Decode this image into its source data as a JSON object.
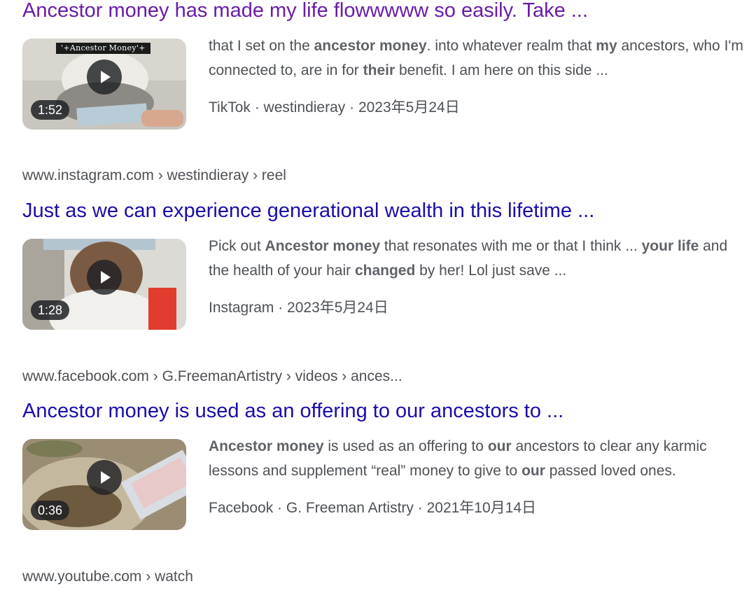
{
  "results": [
    {
      "title": "Ancestor money has made my life flowwwww so easily. Take ...",
      "visited": true,
      "thumbnail": {
        "overlay_text": "'+Ancestor Money'+",
        "duration": "1:52"
      },
      "snippet": [
        {
          "text": "that I set on the ",
          "bold": false
        },
        {
          "text": "ancestor money",
          "bold": true
        },
        {
          "text": ". into whatever realm that ",
          "bold": false
        },
        {
          "text": "my",
          "bold": true
        },
        {
          "text": " ancestors, who I'm connected to, are in for ",
          "bold": false
        },
        {
          "text": "their",
          "bold": true
        },
        {
          "text": " benefit. I am here on this side ...",
          "bold": false
        }
      ],
      "meta": "TikTok · westindieray · 2023年5月24日"
    },
    {
      "cite": "www.instagram.com › westindieray › reel",
      "title": "Just as we can experience generational wealth in this lifetime ...",
      "visited": false,
      "thumbnail": {
        "duration": "1:28"
      },
      "snippet": [
        {
          "text": "Pick out ",
          "bold": false
        },
        {
          "text": "Ancestor money",
          "bold": true
        },
        {
          "text": " that resonates with me or that I think ... ",
          "bold": false
        },
        {
          "text": "your life",
          "bold": true
        },
        {
          "text": " and the health of your hair ",
          "bold": false
        },
        {
          "text": "changed",
          "bold": true
        },
        {
          "text": " by her! Lol just save ...",
          "bold": false
        }
      ],
      "meta": "Instagram · 2023年5月24日"
    },
    {
      "cite": "www.facebook.com › G.FreemanArtistry › videos › ances...",
      "title": "Ancestor money is used as an offering to our ancestors to ...",
      "visited": false,
      "thumbnail": {
        "duration": "0:36"
      },
      "snippet": [
        {
          "text": "Ancestor money",
          "bold": true
        },
        {
          "text": " is used as an offering to ",
          "bold": false
        },
        {
          "text": "our",
          "bold": true
        },
        {
          "text": " ancestors to clear any karmic lessons and supplement “real” money to give to ",
          "bold": false
        },
        {
          "text": "our",
          "bold": true
        },
        {
          "text": " passed loved ones.",
          "bold": false
        }
      ],
      "meta": "Facebook · G. Freeman Artistry · 2021年10月14日"
    },
    {
      "cite": "www.youtube.com › watch"
    }
  ]
}
